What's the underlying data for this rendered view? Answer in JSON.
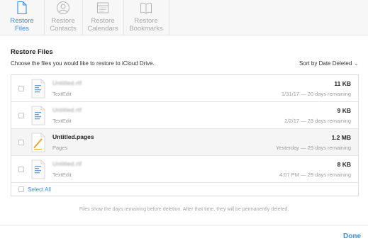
{
  "toolbar": {
    "tabs": [
      {
        "label_line1": "Restore",
        "label_line2": "Files",
        "icon": "document-icon",
        "active": true
      },
      {
        "label_line1": "Restore",
        "label_line2": "Contacts",
        "icon": "contacts-icon",
        "active": false
      },
      {
        "label_line1": "Restore",
        "label_line2": "Calendars",
        "icon": "calendar-icon",
        "active": false
      },
      {
        "label_line1": "Restore",
        "label_line2": "Bookmarks",
        "icon": "book-icon",
        "active": false
      }
    ]
  },
  "panel": {
    "title": "Restore Files",
    "instructions": "Choose the files you would like to restore to iCloud Drive.",
    "sort_label": "Sort by Date Deleted",
    "files": [
      {
        "name": "Untitled.rtf",
        "app": "TextEdit",
        "size": "11 KB",
        "meta": "1/31/17 — 20 days remaining",
        "redacted": true,
        "icon": "textedit-doc-icon"
      },
      {
        "name": "Untitled.rtf",
        "app": "TextEdit",
        "size": "9 KB",
        "meta": "2/2/17 — 23 days remaining",
        "redacted": true,
        "icon": "textedit-doc-icon"
      },
      {
        "name": "Untitled.pages",
        "app": "Pages",
        "size": "1.2 MB",
        "meta": "Yesterday — 29 days remaining",
        "redacted": false,
        "icon": "pages-doc-icon"
      },
      {
        "name": "Untitled.rtf",
        "app": "TextEdit",
        "size": "8 KB",
        "meta": "4:07 PM — 29 days remaining",
        "redacted": true,
        "icon": "textedit-doc-icon"
      }
    ],
    "select_all": "Select All",
    "footnote": "Files show the days remaining before deletion. After that time, they will be permanently deleted.",
    "done": "Done"
  },
  "colors": {
    "accent": "#3a8ee6",
    "muted_text": "#9c9c9c",
    "pages_orange": "#f0a030"
  }
}
